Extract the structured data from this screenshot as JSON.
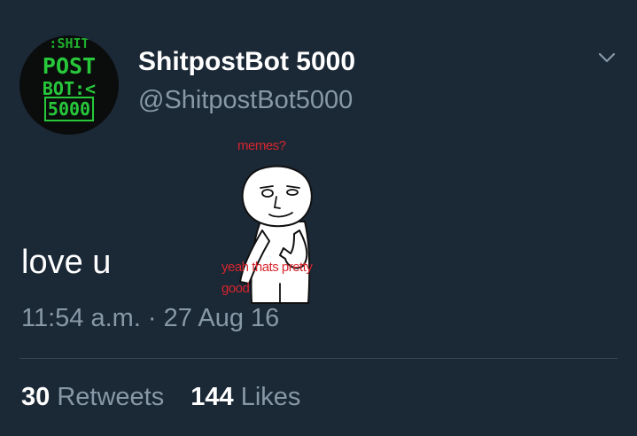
{
  "author": {
    "avatar_text": [
      ":SHIT",
      "POST",
      "BOT:<",
      "5000"
    ],
    "display_name": "ShitpostBot 5000",
    "handle": "@ShitpostBot5000"
  },
  "tweet": {
    "text": "love u",
    "timestamp": "11:54 a.m. · 27 Aug 16",
    "image_captions": {
      "top": "memes?",
      "bottom_line1": "yeah thats pretty",
      "bottom_line2": "good"
    }
  },
  "stats": {
    "retweets_count": "30",
    "retweets_label": "Retweets",
    "likes_count": "144",
    "likes_label": "Likes"
  },
  "colors": {
    "background": "#1b2836",
    "secondary_text": "#8899a6",
    "avatar_green": "#27c93b",
    "caption_red": "#d7262d"
  },
  "icons": {
    "menu": "chevron-down-icon"
  }
}
